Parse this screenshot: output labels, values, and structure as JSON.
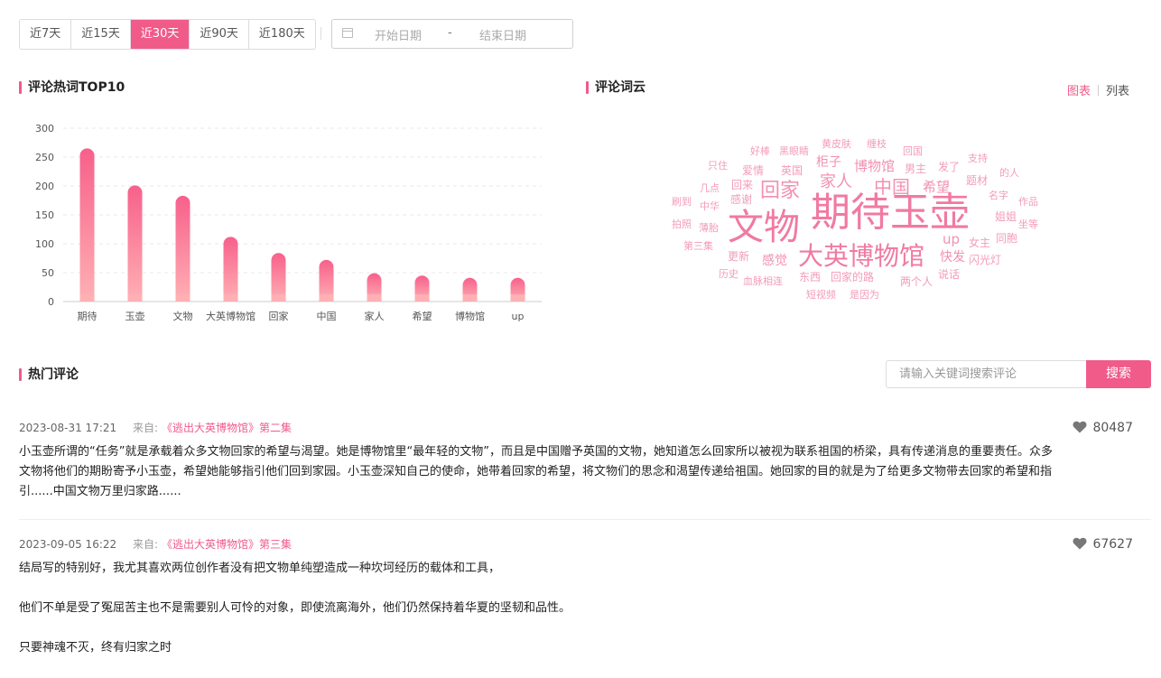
{
  "date_ranges": [
    {
      "label": "近7天",
      "active": false
    },
    {
      "label": "近15天",
      "active": false
    },
    {
      "label": "近30天",
      "active": true
    },
    {
      "label": "近90天",
      "active": false
    },
    {
      "label": "近180天",
      "active": false
    }
  ],
  "date_picker": {
    "start_placeholder": "开始日期",
    "separator": "-",
    "end_placeholder": "结束日期",
    "icon": "calendar-icon"
  },
  "hot_words": {
    "title": "评论热词TOP10"
  },
  "word_cloud": {
    "title": "评论词云",
    "tab_chart": "图表",
    "tab_list": "列表",
    "words": [
      {
        "text": "期待玉壶",
        "size": 44
      },
      {
        "text": "文物",
        "size": 40
      },
      {
        "text": "大英博物馆",
        "size": 28
      },
      {
        "text": "回家",
        "size": 22
      },
      {
        "text": "中国",
        "size": 20
      },
      {
        "text": "家人",
        "size": 18
      },
      {
        "text": "博物馆",
        "size": 15
      },
      {
        "text": "希望",
        "size": 15
      },
      {
        "text": "柜子",
        "size": 14
      },
      {
        "text": "up",
        "size": 15
      },
      {
        "text": "感觉",
        "size": 14
      },
      {
        "text": "快发",
        "size": 14
      },
      {
        "text": "黄皮肤",
        "size": 11
      },
      {
        "text": "缠枝",
        "size": 11
      },
      {
        "text": "好棒",
        "size": 11
      },
      {
        "text": "黑眼睛",
        "size": 11
      },
      {
        "text": "回国",
        "size": 11
      },
      {
        "text": "支持",
        "size": 11
      },
      {
        "text": "只住",
        "size": 11
      },
      {
        "text": "爱情",
        "size": 12
      },
      {
        "text": "英国",
        "size": 12
      },
      {
        "text": "男主",
        "size": 12
      },
      {
        "text": "发了",
        "size": 12
      },
      {
        "text": "的人",
        "size": 11
      },
      {
        "text": "几点",
        "size": 11
      },
      {
        "text": "回来",
        "size": 12
      },
      {
        "text": "题材",
        "size": 12
      },
      {
        "text": "刷到",
        "size": 11
      },
      {
        "text": "感谢",
        "size": 12
      },
      {
        "text": "名字",
        "size": 11
      },
      {
        "text": "作品",
        "size": 11
      },
      {
        "text": "中华",
        "size": 11
      },
      {
        "text": "姐姐",
        "size": 12
      },
      {
        "text": "拍照",
        "size": 11
      },
      {
        "text": "薄胎",
        "size": 11
      },
      {
        "text": "坐等",
        "size": 11
      },
      {
        "text": "同胞",
        "size": 12
      },
      {
        "text": "女主",
        "size": 12
      },
      {
        "text": "第三集",
        "size": 11
      },
      {
        "text": "更新",
        "size": 12
      },
      {
        "text": "闪光灯",
        "size": 12
      },
      {
        "text": "历史",
        "size": 11
      },
      {
        "text": "血脉相连",
        "size": 11
      },
      {
        "text": "东西",
        "size": 12
      },
      {
        "text": "回家的路",
        "size": 12
      },
      {
        "text": "说话",
        "size": 12
      },
      {
        "text": "两个人",
        "size": 12
      },
      {
        "text": "短视频",
        "size": 11
      },
      {
        "text": "是因为",
        "size": 11
      }
    ]
  },
  "chart_data": {
    "type": "bar",
    "title": "评论热词TOP10",
    "categories": [
      "期待",
      "玉壶",
      "文物",
      "大英博物馆",
      "回家",
      "中国",
      "家人",
      "希望",
      "博物馆",
      "up"
    ],
    "values": [
      265,
      201,
      183,
      112,
      84,
      72,
      49,
      45,
      41,
      41
    ],
    "ylim": [
      0,
      300
    ],
    "yticks": [
      0,
      50,
      100,
      150,
      200,
      250,
      300
    ],
    "grid": true,
    "bar_color_top": "#f7608b",
    "bar_color_bottom": "#ffb0b4"
  },
  "hot_comments": {
    "title": "热门评论",
    "search_placeholder": "请输入关键词搜索评论",
    "search_button": "搜索",
    "items": [
      {
        "time": "2023-08-31 17:21",
        "from_label": "来自:",
        "source": "《逃出大英博物馆》第二集",
        "likes": "80487",
        "paragraphs": [
          "小玉壶所谓的“任务”就是承载着众多文物回家的希望与渴望。她是博物馆里“最年轻的文物”，而且是中国赠予英国的文物，她知道怎么回家所以被视为联系祖国的桥梁，具有传递消息的重要责任。众多文物将他们的期盼寄予小玉壶，希望她能够指引他们回到家园。小玉壶深知自己的使命，她带着回家的希望，将文物们的思念和渴望传递给祖国。她回家的目的就是为了给更多文物带去回家的希望和指引......中国文物万里归家路......"
        ]
      },
      {
        "time": "2023-09-05 16:22",
        "from_label": "来自:",
        "source": "《逃出大英博物馆》第三集",
        "likes": "67627",
        "paragraphs": [
          "结局写的特别好，我尤其喜欢两位创作者没有把文物单纯塑造成一种坎坷经历的载体和工具，",
          "他们不单是受了冤屈苦主也不是需要别人可怜的对象，即使流离海外，他们仍然保持着华夏的坚韧和品性。",
          "只要神魂不灭，终有归家之时"
        ]
      }
    ]
  }
}
